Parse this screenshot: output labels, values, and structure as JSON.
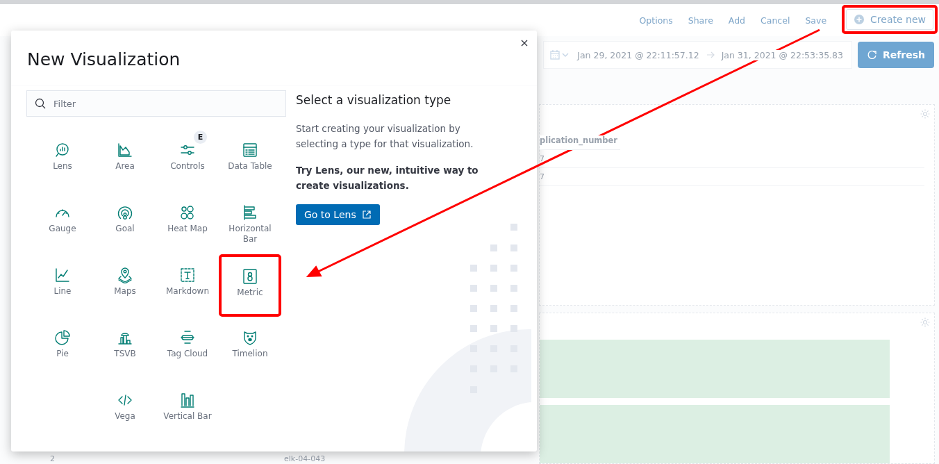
{
  "top_nav": {
    "links": [
      "Options",
      "Share",
      "Add",
      "Cancel",
      "Save"
    ],
    "create_button": {
      "label": "Create new",
      "highlighted": true
    }
  },
  "time_picker": {
    "start": "Jan 29, 2021 @ 22:11:57.12",
    "end": "Jan 31, 2021 @ 22:53:35.83",
    "refresh_label": "Refresh"
  },
  "background_panels": {
    "column_header": "plication_number",
    "cells": [
      "7",
      "7"
    ],
    "row_number": "2",
    "host": "elk-04-043"
  },
  "modal": {
    "title": "New Visualization",
    "filter": {
      "placeholder": "Filter"
    },
    "types": [
      {
        "label": "Lens",
        "highlighted": false
      },
      {
        "label": "Area",
        "highlighted": false
      },
      {
        "label": "Controls",
        "highlighted": false,
        "badge": "E"
      },
      {
        "label": "Data Table",
        "highlighted": false
      },
      {
        "label": "Gauge",
        "highlighted": false
      },
      {
        "label": "Goal",
        "highlighted": false
      },
      {
        "label": "Heat Map",
        "highlighted": false
      },
      {
        "label": "Horizontal Bar",
        "highlighted": false
      },
      {
        "label": "Line",
        "highlighted": false
      },
      {
        "label": "Maps",
        "highlighted": false
      },
      {
        "label": "Markdown",
        "highlighted": false
      },
      {
        "label": "Metric",
        "highlighted": true
      },
      {
        "label": "Pie",
        "highlighted": false
      },
      {
        "label": "TSVB",
        "highlighted": false
      },
      {
        "label": "Tag Cloud",
        "highlighted": false
      },
      {
        "label": "Timelion",
        "highlighted": false
      },
      {
        "label": "Vega",
        "highlighted": false
      },
      {
        "label": "Vertical Bar",
        "highlighted": false
      }
    ],
    "side": {
      "heading": "Select a visualization type",
      "text": "Start creating your visualization by selecting a type for that visualization.",
      "lens_text": "Try Lens, our new, intuitive way to create visualizations.",
      "button": "Go to Lens"
    }
  },
  "annotation_arrow": true
}
